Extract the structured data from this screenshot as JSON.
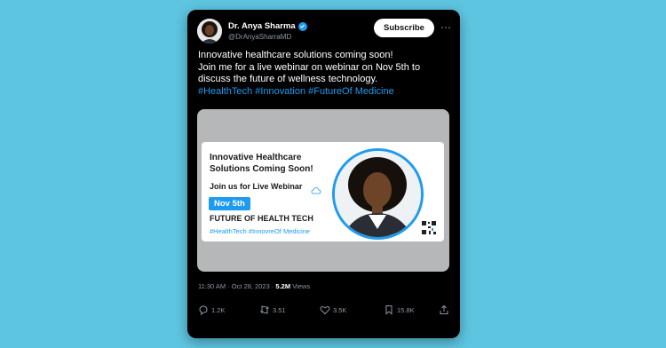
{
  "post": {
    "author_name": "Dr. Anya Sharma",
    "author_handle": "@DrAnyaSharraMD",
    "subscribe_label": "Subscribe",
    "text_line1": "Innovative healthcare solutions coming soon!",
    "text_line2": "Join me for a live webinar on webinar on Nov 5th to",
    "text_line3": "discuss the future of wellness technology.",
    "hashtags": "#HealthTech #Innovation #FutureOf Medicine",
    "timestamp": "11:30 AM · Oct 28, 2023 · ",
    "views_count": "5.2M",
    "views_label": " Views"
  },
  "banner": {
    "title": "Innovative Healthcare Solutions Coming Soon!",
    "join": "Join us for Live Webinar",
    "date": "Nov 5th",
    "subtitle": "FUTURE OF HEALTH TECH",
    "tags": "#HealthTech #InnovreOf Medicine"
  },
  "actions": {
    "replies": "1.2K",
    "reposts": "3.51",
    "likes": "3.5K",
    "bookmarks": "15.8K"
  },
  "colors": {
    "background": "#5ec5e1",
    "accent": "#1d9bf0",
    "card": "#000000",
    "muted": "#8b98a5"
  },
  "icons": [
    "verified-badge-icon",
    "more-options-icon",
    "cloud-icon",
    "qr-code-icon",
    "reply-icon",
    "repost-icon",
    "like-icon",
    "bookmark-icon",
    "share-icon"
  ]
}
